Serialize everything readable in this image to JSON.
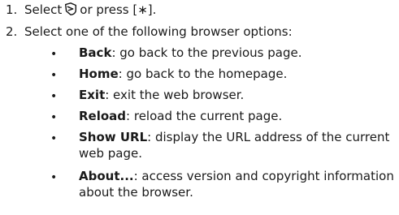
{
  "steps": [
    {
      "number": "1.",
      "before_icon": "Select",
      "icon": "browser-menu-icon",
      "after_icon": "or press [∗]."
    },
    {
      "number": "2.",
      "text": "Select one of the following browser options:"
    }
  ],
  "options": [
    {
      "name": "Back",
      "desc": ": go back to the previous page."
    },
    {
      "name": "Home",
      "desc": ": go back to the homepage."
    },
    {
      "name": "Exit",
      "desc": ": exit the web browser."
    },
    {
      "name": "Reload",
      "desc": ": reload the current page."
    },
    {
      "name": "Show URL",
      "desc": ": display the URL address of the current web page."
    },
    {
      "name": "About...",
      "desc": ": access version and copyright information about the browser."
    }
  ],
  "bullet": "•"
}
